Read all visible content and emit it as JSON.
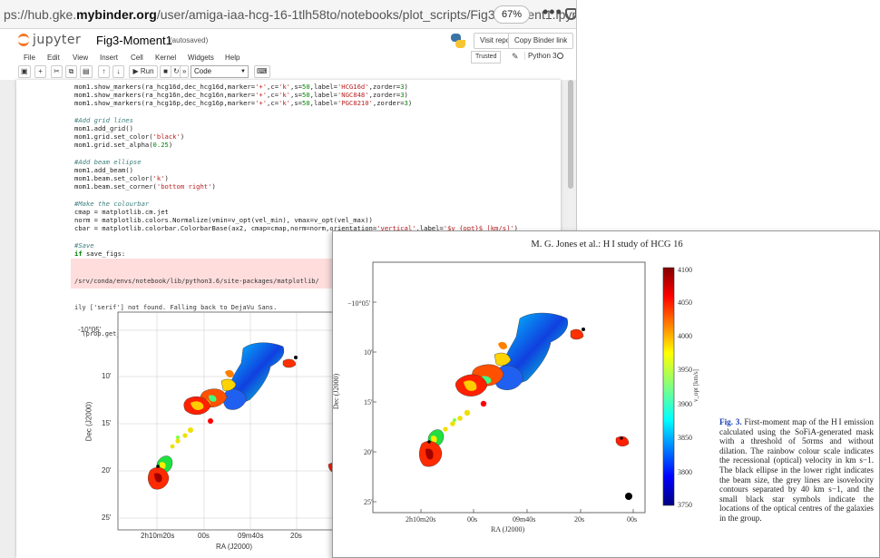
{
  "browser": {
    "url_prefix": "ps://hub.gke.",
    "url_domain": "mybinder.org",
    "url_path": "/user/amiga-iaa-hcg-16-1tlh58to/notebooks/plot_scripts/Fig3-Moment1.ipyn",
    "zoom": "67%",
    "menu_glyph": "•••"
  },
  "jupyter": {
    "logo_text": "jupyter",
    "notebook_name": "Fig3-Moment1",
    "save_status": "(autosaved)",
    "visit_repo_label": "Visit repo",
    "copy_binder_label": "Copy Binder link",
    "trusted_label": "Trusted",
    "kernel_name": "Python 3",
    "menu": [
      "File",
      "Edit",
      "View",
      "Insert",
      "Cell",
      "Kernel",
      "Widgets",
      "Help"
    ],
    "toolbar": {
      "save_glyph": "▣",
      "add_glyph": "+",
      "cut_glyph": "✂",
      "copy_glyph": "⧉",
      "paste_glyph": "▤",
      "up_glyph": "↑",
      "down_glyph": "↓",
      "run_label": "▶ Run",
      "stop_glyph": "■",
      "restart_glyph": "↻",
      "fastforward_glyph": "»",
      "cell_type": "Code",
      "keyboard_glyph": "⌨"
    }
  },
  "code": {
    "lines": [
      [
        {
          "t": "mom1.show_markers(ra_hcg16d,dec_hcg16d,marker="
        },
        {
          "t": "'+'",
          "c": "str"
        },
        {
          "t": ",c="
        },
        {
          "t": "'k'",
          "c": "str"
        },
        {
          "t": ",s="
        },
        {
          "t": "50",
          "c": "num"
        },
        {
          "t": ",label="
        },
        {
          "t": "'HCG16d'",
          "c": "str"
        },
        {
          "t": ",zorder="
        },
        {
          "t": "3",
          "c": "num"
        },
        {
          "t": ")"
        }
      ],
      [
        {
          "t": "mom1.show_markers(ra_hcg16n,dec_hcg16n,marker="
        },
        {
          "t": "'+'",
          "c": "str"
        },
        {
          "t": ",c="
        },
        {
          "t": "'k'",
          "c": "str"
        },
        {
          "t": ",s="
        },
        {
          "t": "50",
          "c": "num"
        },
        {
          "t": ",label="
        },
        {
          "t": "'NGC848'",
          "c": "str"
        },
        {
          "t": ",zorder="
        },
        {
          "t": "3",
          "c": "num"
        },
        {
          "t": ")"
        }
      ],
      [
        {
          "t": "mom1.show_markers(ra_hcg16p,dec_hcg16p,marker="
        },
        {
          "t": "'+'",
          "c": "str"
        },
        {
          "t": ",c="
        },
        {
          "t": "'k'",
          "c": "str"
        },
        {
          "t": ",s="
        },
        {
          "t": "50",
          "c": "num"
        },
        {
          "t": ",label="
        },
        {
          "t": "'PGC8210'",
          "c": "str"
        },
        {
          "t": ",zorder="
        },
        {
          "t": "3",
          "c": "num"
        },
        {
          "t": ")"
        }
      ],
      [],
      [
        {
          "t": "#Add grid lines",
          "c": "com"
        }
      ],
      [
        {
          "t": "mom1.add_grid()"
        }
      ],
      [
        {
          "t": "mom1.grid.set_color("
        },
        {
          "t": "'black'",
          "c": "str"
        },
        {
          "t": ")"
        }
      ],
      [
        {
          "t": "mom1.grid.set_alpha("
        },
        {
          "t": "0.25",
          "c": "num"
        },
        {
          "t": ")"
        }
      ],
      [],
      [
        {
          "t": "#Add beam ellipse",
          "c": "com"
        }
      ],
      [
        {
          "t": "mom1.add_beam()"
        }
      ],
      [
        {
          "t": "mom1.beam.set_color("
        },
        {
          "t": "'k'",
          "c": "str"
        },
        {
          "t": ")"
        }
      ],
      [
        {
          "t": "mom1.beam.set_corner("
        },
        {
          "t": "'bottom right'",
          "c": "str"
        },
        {
          "t": ")"
        }
      ],
      [],
      [
        {
          "t": "#Make the colourbar",
          "c": "com"
        }
      ],
      [
        {
          "t": "cmap = matplotlib.cm.jet"
        }
      ],
      [
        {
          "t": "norm = matplotlib.colors.Normalize(vmin=v_opt(vel_min), vmax=v_opt(vel_max))"
        }
      ],
      [
        {
          "t": "cbar = matplotlib.colorbar.ColorbarBase(ax2, cmap=cmap,norm=norm,orientation="
        },
        {
          "t": "'vertical'",
          "c": "str"
        },
        {
          "t": ",label="
        },
        {
          "t": "'$v_{opt}$ [km/s]'",
          "c": "str"
        },
        {
          "t": ")"
        }
      ],
      [],
      [
        {
          "t": "#Save",
          "c": "com"
        }
      ],
      [
        {
          "t": "if",
          "c": "kw"
        },
        {
          "t": " save_figs:"
        }
      ],
      [
        {
          "t": "    fig.savefig("
        },
        {
          "t": "'Fig3-HCG16_mom1.pdf'",
          "c": "str"
        },
        {
          "t": ",bbox_inches="
        },
        {
          "t": "'tight'",
          "c": "str"
        },
        {
          "t": ")"
        }
      ]
    ],
    "stderr": [
      "/srv/conda/envs/notebook/lib/python3.6/site-packages/matplotlib/",
      "ily ['serif'] not found. Falling back to DejaVu Sans.",
      "  (prop.get_family(), self.defaultFamily[fontext]))"
    ]
  },
  "notebook_plot": {
    "ylabel": "Dec (J2000)",
    "xlabel": "RA (J2000)",
    "yticks": [
      "-10°05'",
      "10'",
      "15'",
      "20'",
      "25'"
    ],
    "xticks": [
      "2h10m20s",
      "00s",
      "09m40s",
      "20s"
    ]
  },
  "paper": {
    "header": "M. G. Jones et al.: H I study of HCG 16",
    "ylabel": "Dec (J2000)",
    "xlabel": "RA (J2000)",
    "yticks": [
      "−10°05′",
      "10′",
      "15′",
      "20′",
      "25′"
    ],
    "xticks": [
      "2h10m20s",
      "00s",
      "09m40s",
      "20s",
      "00s"
    ],
    "colorbar_label": "v_opt [km/s]",
    "colorbar_ticks": [
      "4100",
      "4050",
      "4000",
      "3950",
      "3900",
      "3850",
      "3800",
      "3750"
    ],
    "caption_label": "Fig. 3.",
    "caption_text": " First-moment map of the H I emission calculated using the SoFiA-generated mask with a threshold of 5σrms and without dilation. The rainbow colour scale indicates the recessional (optical) velocity in km s−1. The black ellipse in the lower right indicates the beam size, the grey lines are isovelocity contours separated by 40 km s−1, and the small black star symbols indicate the locations of the optical centres of the galaxies in the group."
  },
  "colors": {
    "jupyter_orange": "#f37726",
    "stderr_bg": "#ffdddd",
    "caption_blue": "#1a3fb5"
  }
}
